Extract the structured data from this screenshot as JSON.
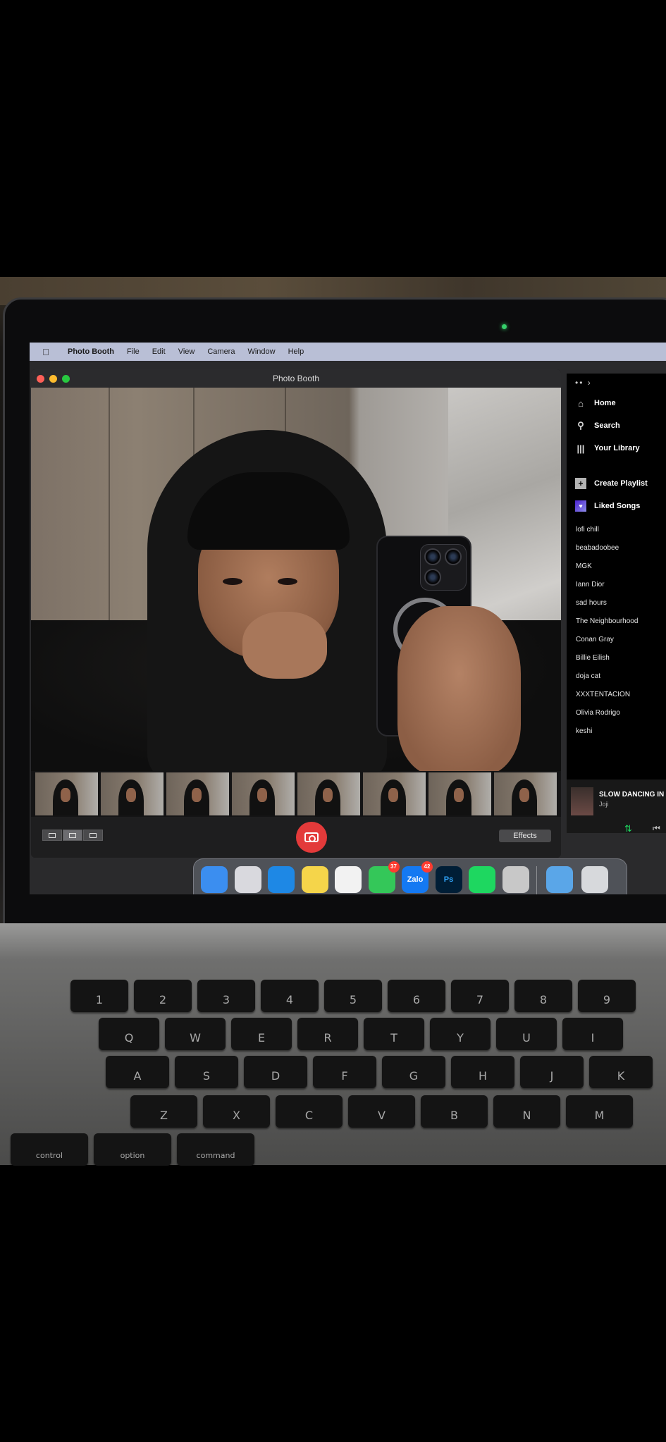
{
  "menubar": {
    "app_name": "Photo Booth",
    "items": [
      "File",
      "Edit",
      "View",
      "Camera",
      "Window",
      "Help"
    ]
  },
  "photobooth": {
    "window_title": "Photo Booth",
    "effects_label": "Effects",
    "thumbnail_count": 8
  },
  "spotify": {
    "nav": [
      {
        "label": "Home",
        "icon": "home-icon"
      },
      {
        "label": "Search",
        "icon": "search-icon"
      },
      {
        "label": "Your Library",
        "icon": "library-icon"
      }
    ],
    "actions": [
      {
        "label": "Create Playlist",
        "icon": "plus-icon"
      },
      {
        "label": "Liked Songs",
        "icon": "heart-icon"
      }
    ],
    "playlists": [
      "lofi chill",
      "beabadoobee",
      "MGK",
      "Iann Dior",
      "sad hours",
      "The Neighbourhood",
      "Conan Gray",
      "Billie Eilish",
      "doja cat",
      "XXXTENTACION",
      "Olivia Rodrigo",
      "keshi"
    ],
    "now_playing": {
      "title": "SLOW DANCING IN T",
      "artist": "Joji"
    }
  },
  "dock": {
    "apps": [
      {
        "name": "finder-icon",
        "label": "",
        "color": "#3b8ef0"
      },
      {
        "name": "launchpad-icon",
        "label": "",
        "color": "#d9d9de"
      },
      {
        "name": "safari-icon",
        "label": "",
        "color": "#1e88e5"
      },
      {
        "name": "notes-icon",
        "label": "",
        "color": "#f5d54a"
      },
      {
        "name": "photos-icon",
        "label": "",
        "color": "#f2f2f2"
      },
      {
        "name": "messages-icon",
        "label": "",
        "color": "#34c759",
        "badge": "37"
      },
      {
        "name": "zalo-icon",
        "label": "Zalo",
        "color": "#1479f2",
        "badge": "42"
      },
      {
        "name": "photoshop-icon",
        "label": "Ps",
        "color": "#001e36"
      },
      {
        "name": "spotify-icon",
        "label": "",
        "color": "#1ed760"
      },
      {
        "name": "photo-booth-icon",
        "label": "",
        "color": "#c8c8c8"
      },
      {
        "name": "downloads-folder-icon",
        "label": "",
        "color": "#5aa6e8"
      },
      {
        "name": "trash-icon",
        "label": "",
        "color": "#d7d9dc"
      }
    ]
  },
  "keyboard": {
    "row_numbers": [
      "1",
      "2",
      "3",
      "4",
      "5",
      "6",
      "7",
      "8",
      "9"
    ],
    "row_q": [
      "Q",
      "W",
      "E",
      "R",
      "T",
      "Y",
      "U",
      "I"
    ],
    "row_a": [
      "A",
      "S",
      "D",
      "F",
      "G",
      "H",
      "J",
      "K"
    ],
    "row_z": [
      "Z",
      "X",
      "C",
      "V",
      "B",
      "N",
      "M"
    ],
    "row_mod": [
      "control",
      "option",
      "command"
    ]
  },
  "colors": {
    "spotify_green": "#1ed760",
    "shutter_red": "#e33a3a",
    "menubar": "#b9bfd6"
  }
}
